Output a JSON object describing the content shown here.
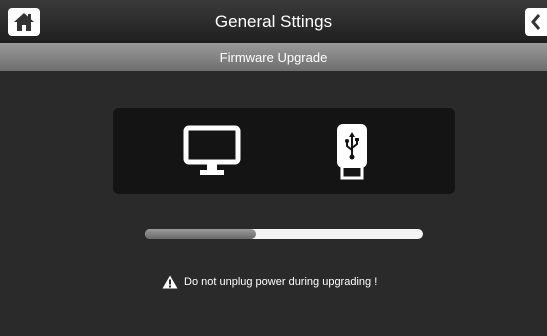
{
  "header": {
    "title": "General Sttings",
    "home_icon": "home-icon",
    "back_icon": "chevron-left-icon"
  },
  "subheader": {
    "title": "Firmware Upgrade"
  },
  "devices": {
    "source_icon": "monitor-icon",
    "target_icon": "usb-drive-icon"
  },
  "progress": {
    "value": 0.4
  },
  "warning": {
    "icon": "warning-icon",
    "text": "Do not unplug power during upgrading !"
  },
  "colors": {
    "background": "#2a2a2a",
    "header": "#2b2b2b",
    "subheader": "#858585",
    "panel": "#141414",
    "progress_fill": "#808080",
    "progress_track": "#f4f4f4"
  }
}
